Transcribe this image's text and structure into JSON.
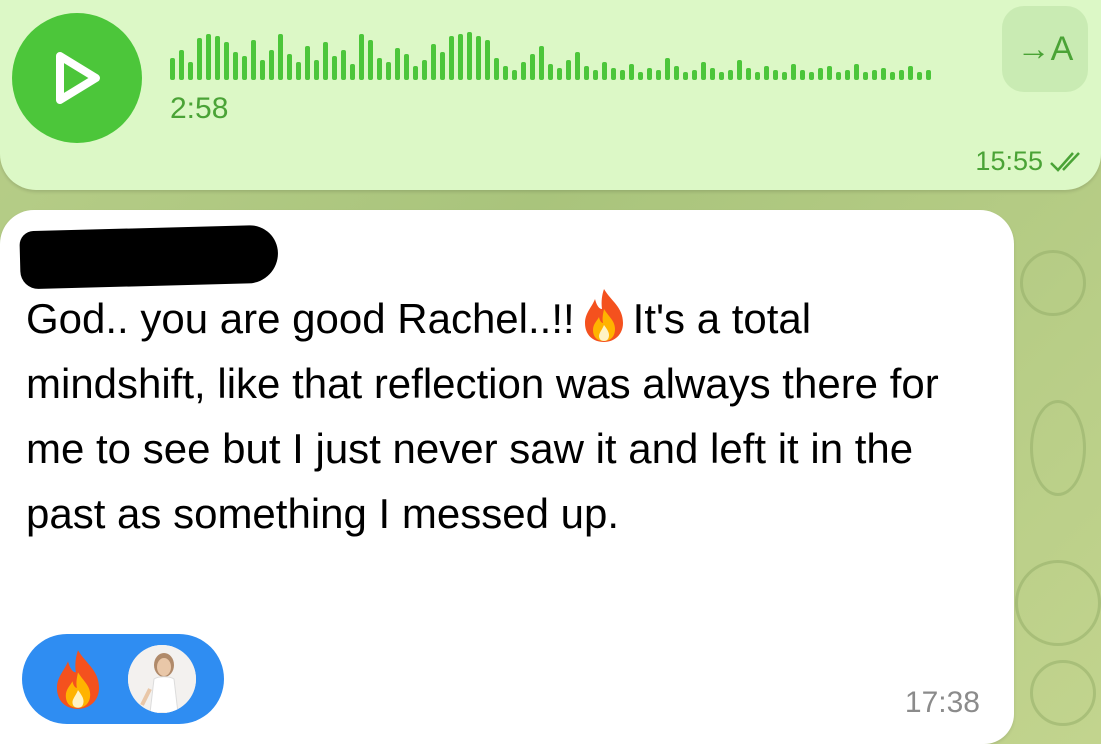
{
  "voice_message": {
    "duration": "2:58",
    "transcribe_label": "→A",
    "time": "15:55",
    "status_icon": "double-check-icon",
    "accent_color": "#4cc63a"
  },
  "incoming_message": {
    "text_part1": "God.. you are good Rachel..!!",
    "text_emoji": "fire",
    "text_part2": "It's a total mindshift, like that reflection was always there for me to see but I just never saw it and left it in the past as something I messed up.",
    "time": "17:38",
    "reaction": {
      "emoji": "fire",
      "pill_color": "#2f8df2"
    }
  }
}
